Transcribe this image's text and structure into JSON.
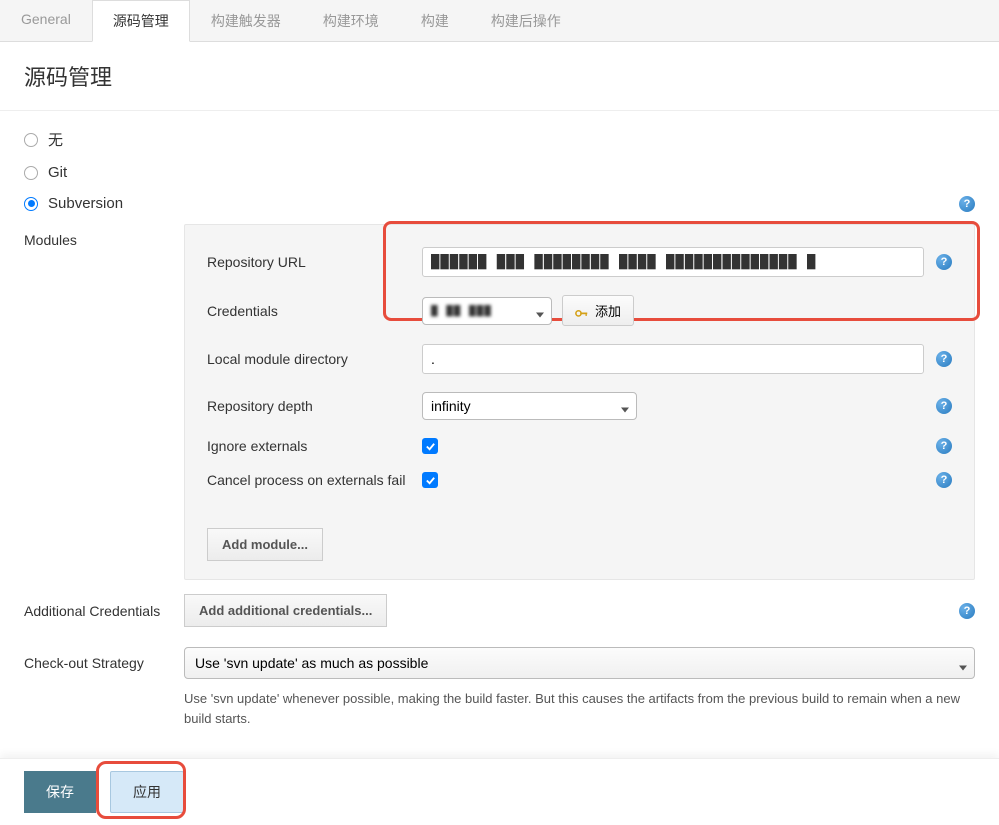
{
  "tabs": {
    "general": "General",
    "scm": "源码管理",
    "triggers": "构建触发器",
    "env": "构建环境",
    "build": "构建",
    "post": "构建后操作"
  },
  "section_title": "源码管理",
  "scm_options": {
    "none": "无",
    "git": "Git",
    "svn": "Subversion"
  },
  "modules": {
    "label": "Modules",
    "repo_url_label": "Repository URL",
    "repo_url_value": "██████ ███ ████████ ████ ██████████████ █",
    "credentials_label": "Credentials",
    "credentials_value": "█ ██ ███",
    "add_button": "添加",
    "local_dir_label": "Local module directory",
    "local_dir_value": ".",
    "depth_label": "Repository depth",
    "depth_value": "infinity",
    "ignore_externals_label": "Ignore externals",
    "cancel_externals_label": "Cancel process on externals fail",
    "add_module": "Add module..."
  },
  "additional_credentials": {
    "label": "Additional Credentials",
    "button": "Add additional credentials..."
  },
  "checkout_strategy": {
    "label": "Check-out Strategy",
    "value": "Use 'svn update' as much as possible",
    "description": "Use 'svn update' whenever possible, making the build faster. But this causes the artifacts from the previous build to remain when a new build starts."
  },
  "footer": {
    "save": "保存",
    "apply": "应用"
  },
  "help_glyph": "?"
}
